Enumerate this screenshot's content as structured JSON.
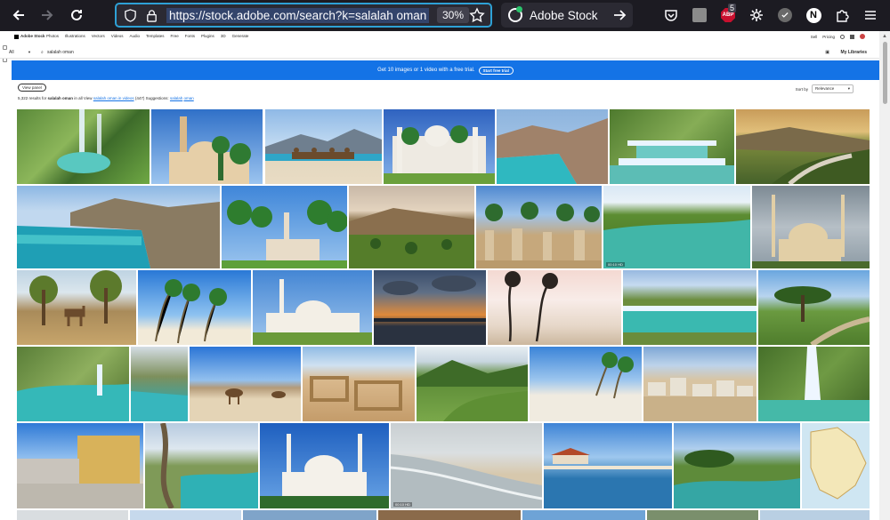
{
  "browser": {
    "url": "https://stock.adobe.com/search?k=salalah oman",
    "zoom": "30%",
    "search_engine": "Adobe Stock",
    "notifications_badge": "5",
    "profile_initial": "N",
    "abp_label": "ABP"
  },
  "site": {
    "brand": "Adobe Stock",
    "nav_links": [
      "Photos",
      "Illustrations",
      "Vectors",
      "Videos",
      "Audio",
      "Templates",
      "Free",
      "Fonts",
      "Plugins",
      "3D",
      "Generate"
    ],
    "nav_right": [
      "Sell",
      "Pricing"
    ],
    "search_category": "All",
    "search_query": "salalah oman",
    "library_label": "My Libraries",
    "promo_text": "Get 10 images or 1 video with a free trial.",
    "promo_cta": "Start free trial",
    "view_panel_label": "View panel",
    "results_count": "5,322 results for",
    "results_query": "salalah oman",
    "results_scope": "in all",
    "view_link_prefix": "View",
    "view_link": "salalah oman in videos",
    "view_link_count": "(447)",
    "suggestions_label": "Suggestions:",
    "suggestion_link1": "salalah",
    "suggestion_link2": "oman",
    "sort_label": "Sort by",
    "sort_value": "Relevance",
    "video_badge": "00:10 HD"
  },
  "accent_colors": {
    "url_focus": "#2ea1d6",
    "promo_blue": "#1473e6",
    "chrome_bg": "#1c1b22"
  }
}
